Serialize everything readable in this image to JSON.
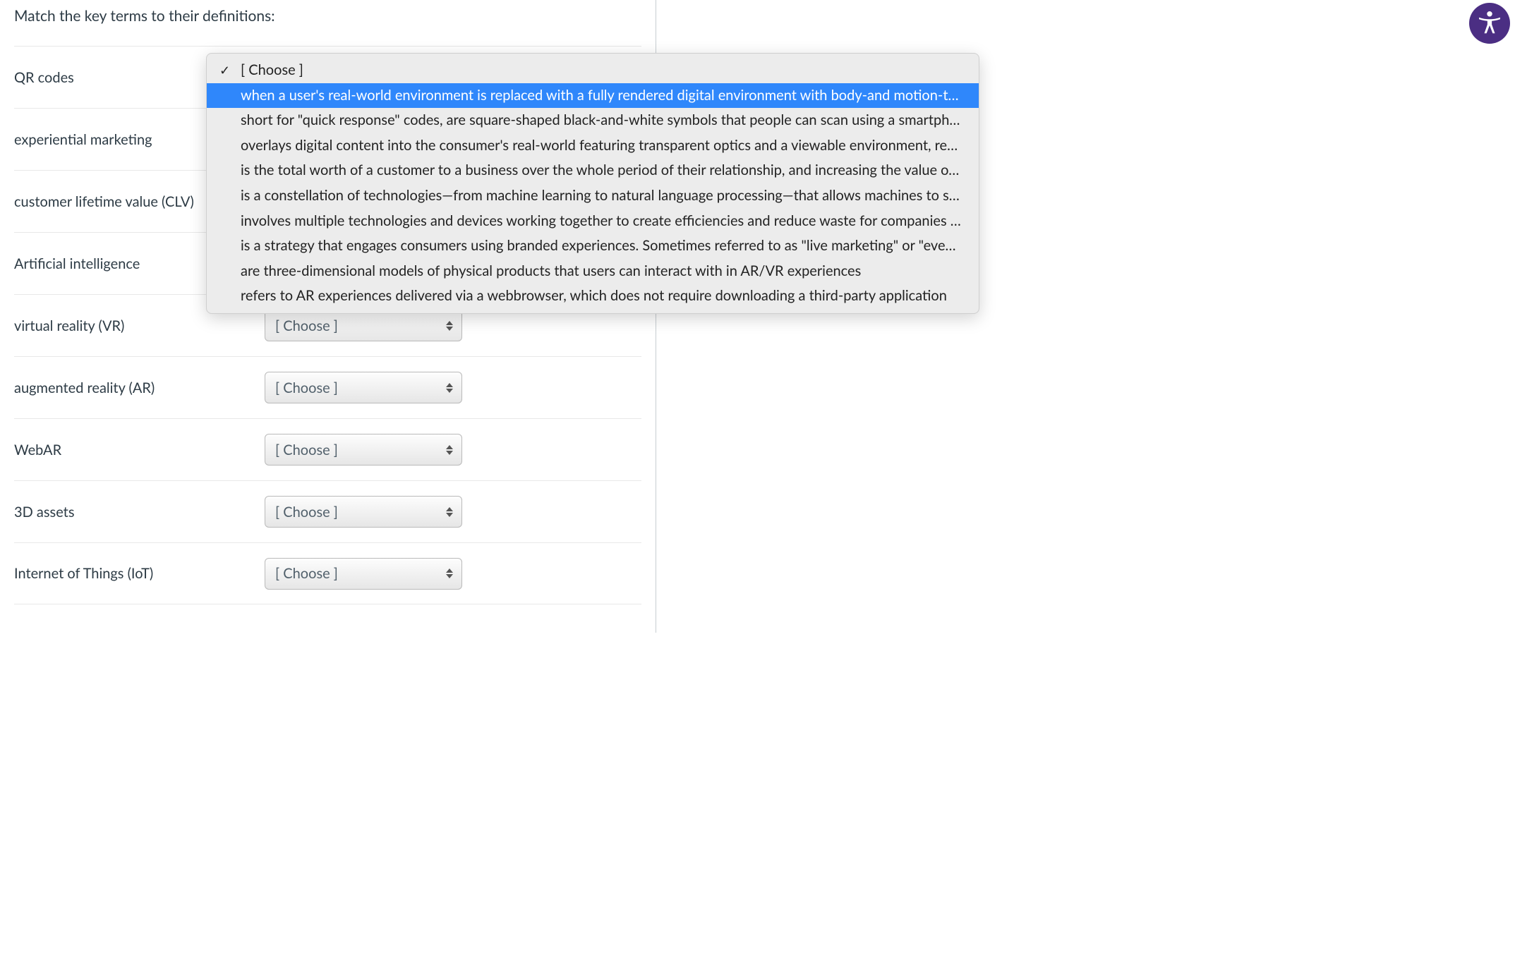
{
  "question": {
    "prompt": "Match the key terms to their definitions:"
  },
  "placeholder": "[ Choose ]",
  "rows": [
    {
      "term": "QR codes"
    },
    {
      "term": "experiential marketing"
    },
    {
      "term": "customer lifetime value (CLV)"
    },
    {
      "term": "Artificial intelligence"
    },
    {
      "term": "virtual reality (VR)"
    },
    {
      "term": "augmented reality (AR)"
    },
    {
      "term": "WebAR"
    },
    {
      "term": "3D assets"
    },
    {
      "term": "Internet of Things (IoT)"
    }
  ],
  "dropdown": {
    "selected_index": 0,
    "highlight_index": 1,
    "options": [
      "[ Choose ]",
      "when a user's real-world environment is replaced with a fully rendered digital environment with body-and motion-tracking",
      "short for \"quick response\" codes, are square-shaped black-and-white symbols that people can scan using a smartphone to",
      "overlays digital content into the consumer's real-world featuring transparent optics and a viewable environment, real-time",
      "is the total worth of a customer to a business over the whole period of their relationship, and increasing the value of existing",
      "is a constellation of technologies—from machine learning to natural language processing—that allows machines to sense,",
      "involves multiple technologies and devices working together to create efficiencies and reduce waste for companies and",
      "is a strategy that engages consumers using branded experiences. Sometimes referred to as \"live marketing\" or \"event marketing",
      "are three-dimensional models of physical products that users can interact with in AR/VR experiences",
      "refers to AR experiences delivered via a webbrowser, which does not require downloading a third-party application"
    ]
  }
}
